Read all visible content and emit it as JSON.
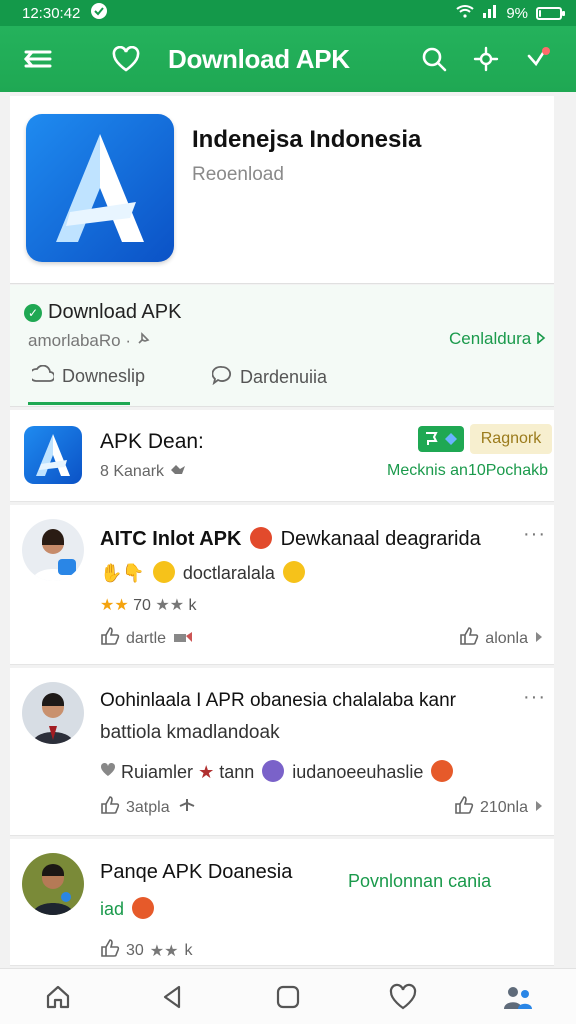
{
  "status": {
    "time": "12:30:42",
    "battery": "9%",
    "battery_level": 0.09
  },
  "appbar": {
    "title": "Download APK"
  },
  "app": {
    "name": "Indenejsa Indonesia",
    "subtitle": "Reoenload"
  },
  "download": {
    "title": "Download APK",
    "meta": "amorlabaRo ·",
    "link": "Cenlaldura",
    "tabs": [
      "Downeslip",
      "Dardenuiia"
    ],
    "active_tab": 0
  },
  "apk_row": {
    "title": "APK Dean:",
    "meta": "8 Kanark",
    "badge": "Ragnork",
    "note": "Mecknis an10Pochakb"
  },
  "posts": [
    {
      "title": "AITC Inlot APK",
      "title_tail": "Dewkanaal deagrarida",
      "line2": "doctlaralala",
      "rating": "70",
      "rating_suffix": "k",
      "action_left": "dartle",
      "action_right": "alonla"
    },
    {
      "line1": "Oohinlaala I APR obanesia chalalaba kanr",
      "line2": "battiola kmadlandoak",
      "line3a": "Ruiamler",
      "line3b": "tann",
      "line3c": "iudanoeeuhaslie",
      "action_left": "3atpla",
      "action_right": "210nla"
    },
    {
      "title": "Panqe APK Doanesia",
      "link": "Povnlonnan cania",
      "line2": "iad",
      "rating": "30",
      "rating_suffix": "k"
    }
  ],
  "colors": {
    "primary": "#1fa853",
    "accent_text": "#1b9a4c",
    "star": "#f4a30f"
  }
}
